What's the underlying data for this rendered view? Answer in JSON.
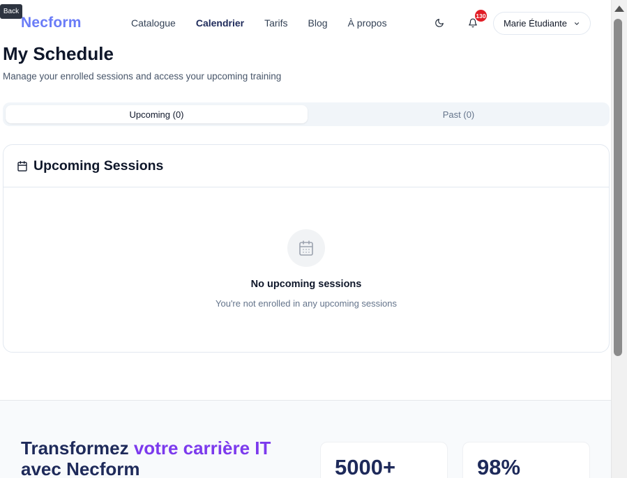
{
  "back": {
    "label": "Back"
  },
  "header": {
    "logo": "Necform",
    "nav": [
      {
        "label": "Catalogue",
        "active": false
      },
      {
        "label": "Calendrier",
        "active": true
      },
      {
        "label": "Tarifs",
        "active": false
      },
      {
        "label": "Blog",
        "active": false
      },
      {
        "label": "À propos",
        "active": false
      }
    ],
    "notifications_count": "130",
    "user_name": "Marie Étudiante"
  },
  "page": {
    "title": "My Schedule",
    "subtitle": "Manage your enrolled sessions and access your upcoming training"
  },
  "tabs": [
    {
      "label": "Upcoming (0)",
      "active": true
    },
    {
      "label": "Past (0)",
      "active": false
    }
  ],
  "sessions_card": {
    "title": "Upcoming Sessions",
    "empty_title": "No upcoming sessions",
    "empty_description": "You're not enrolled in any upcoming sessions"
  },
  "promo": {
    "title_part1": "Transformez ",
    "title_accent": "votre carrière IT",
    "title_part2": "avec Necform",
    "stats": [
      "5000+",
      "98%"
    ]
  },
  "colors": {
    "brand": "#6a7cf7",
    "navy": "#1e2a5a",
    "accent_purple": "#7c3aed",
    "badge_red": "#e11d26"
  }
}
